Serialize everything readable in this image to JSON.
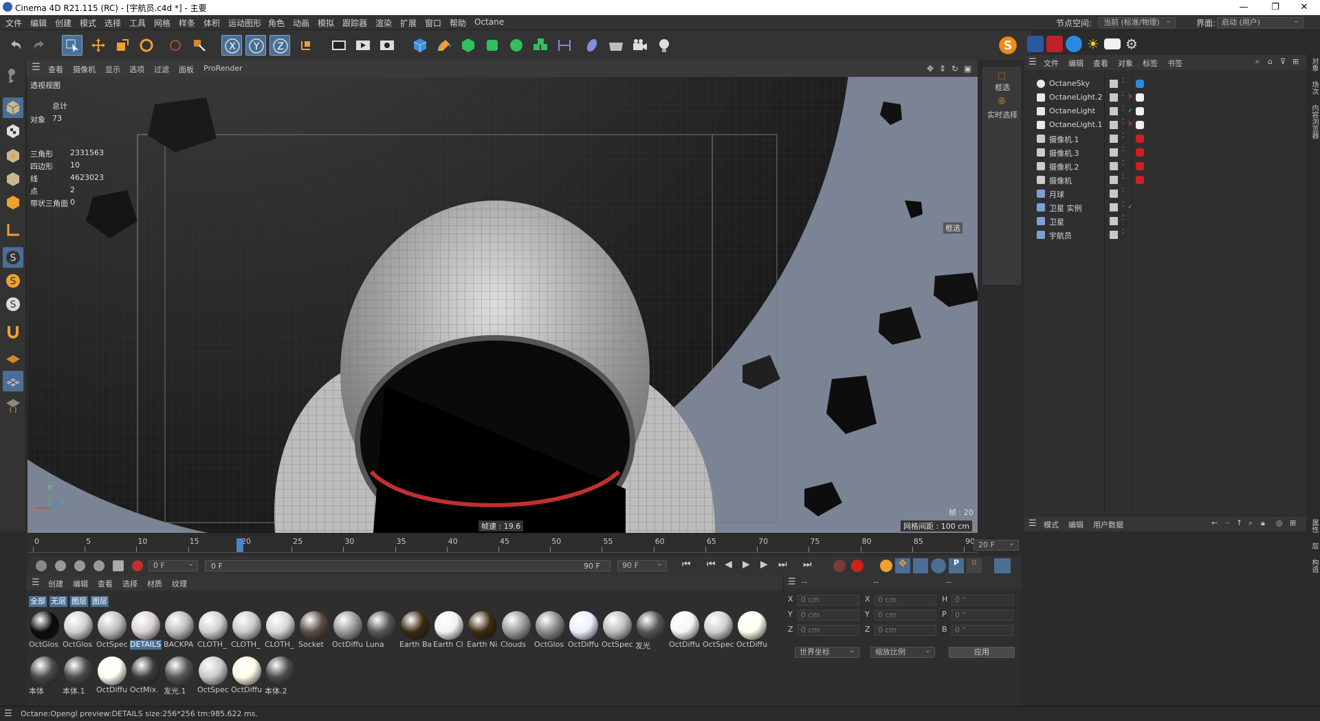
{
  "window": {
    "title": "Cinema 4D R21.115 (RC) - [宇航员.c4d *] - 主要",
    "min": "—",
    "max": "❐",
    "close": "✕"
  },
  "menu": [
    "文件",
    "编辑",
    "创建",
    "模式",
    "选择",
    "工具",
    "网格",
    "样条",
    "体积",
    "运动图形",
    "角色",
    "动画",
    "模拟",
    "跟踪器",
    "渲染",
    "扩展",
    "窗口",
    "帮助",
    "Octane"
  ],
  "node_space": {
    "label": "节点空间:",
    "value": "当前 (标准/物理)"
  },
  "interface": {
    "label": "界面:",
    "value": "启动 (用户)"
  },
  "viewport_menu": [
    "查看",
    "摄像机",
    "显示",
    "选项",
    "过滤",
    "面板",
    "ProRender"
  ],
  "viewport": {
    "name": "透视视图",
    "stats": {
      "total_label": "总计",
      "rows": [
        [
          "对象",
          "73"
        ],
        [
          "三角形",
          "2331563"
        ],
        [
          "四边形",
          "10"
        ],
        [
          "线",
          "4623023"
        ],
        [
          "点",
          "2"
        ],
        [
          "带状三角面",
          "0"
        ]
      ]
    },
    "fps": "帧速 : 19.6",
    "frame": "帧 : 20",
    "grid": "网格间距 : 100 cm",
    "filter_tag": "框选",
    "axes": {
      "x": "X",
      "y": "Y",
      "z": "Z"
    }
  },
  "right_strip": {
    "select": "框选",
    "live": "实时选择"
  },
  "object_manager": {
    "menu": [
      "文件",
      "编辑",
      "查看",
      "对象",
      "标签",
      "书签"
    ],
    "objects": [
      {
        "name": "OctaneSky",
        "check": ""
      },
      {
        "name": "OctaneLight.2",
        "check": "✕"
      },
      {
        "name": "OctaneLight",
        "check": "✓"
      },
      {
        "name": "OctaneLight.1",
        "check": "✕"
      },
      {
        "name": "摄像机.1",
        "check": ""
      },
      {
        "name": "摄像机.3",
        "check": ""
      },
      {
        "name": "摄像机.2",
        "check": ""
      },
      {
        "name": "摄像机",
        "check": ""
      },
      {
        "name": "月球",
        "check": ""
      },
      {
        "name": "卫星 实例",
        "check": "✓"
      },
      {
        "name": "卫星",
        "check": ""
      },
      {
        "name": "宇航员",
        "check": ""
      }
    ]
  },
  "right_tabs": [
    "对象",
    "场次",
    "内容浏览器"
  ],
  "right_tabs2": [
    "属性",
    "层",
    "构造"
  ],
  "attributes": {
    "menu": [
      "模式",
      "编辑",
      "用户数据"
    ]
  },
  "timeline": {
    "ticks": [
      "0",
      "5",
      "10",
      "15",
      "20",
      "25",
      "30",
      "35",
      "40",
      "45",
      "50",
      "55",
      "60",
      "65",
      "70",
      "75",
      "80",
      "85",
      "90"
    ],
    "current": "20 F",
    "current_frame": 20,
    "max_frame": 90
  },
  "transport": {
    "start": "0 F",
    "range_start": "0 F",
    "range_end": "90 F",
    "end": "90 F"
  },
  "material_manager": {
    "menu": [
      "创建",
      "编辑",
      "查看",
      "选择",
      "材质",
      "纹理"
    ],
    "filters": [
      "全部",
      "无层",
      "图层",
      "图层"
    ],
    "materials": [
      {
        "label": "OctGlos",
        "color": "#0b0b0b"
      },
      {
        "label": "OctGlos",
        "color": "#cfcfcf"
      },
      {
        "label": "OctSpec",
        "color": "#bdbdbd"
      },
      {
        "label": "DETAILS",
        "color": "#d9d0d0"
      },
      {
        "label": "BACKPA",
        "color": "#bbbbbb"
      },
      {
        "label": "CLOTH_",
        "color": "#cfcfcf"
      },
      {
        "label": "CLOTH_",
        "color": "#c9c9c9"
      },
      {
        "label": "CLOTH_",
        "color": "#d4d4d4"
      },
      {
        "label": "Socket",
        "color": "#5a4d44"
      },
      {
        "label": "OctDiffu",
        "color": "#999999"
      },
      {
        "label": "Luna",
        "color": "#555555"
      },
      {
        "label": "Earth Ba",
        "color": "#3a2a10"
      },
      {
        "label": "Earth Cl",
        "color": "#f2f2f2"
      },
      {
        "label": "Earth Ni",
        "color": "#3a2a10"
      },
      {
        "label": "Clouds",
        "color": "#999999"
      },
      {
        "label": "OctGlos",
        "color": "#8a8a8a"
      },
      {
        "label": "OctDiffu",
        "color": "#e8f0ff"
      },
      {
        "label": "OctSpec",
        "color": "#bcbcbc"
      },
      {
        "label": "发光",
        "color": "#555555"
      },
      {
        "label": "OctDiffu",
        "color": "#f5f5f5"
      },
      {
        "label": "OctSpec",
        "color": "#cfcfcf"
      },
      {
        "label": "OctDiffu",
        "color": "#fffff0"
      },
      {
        "label": "本体",
        "color": "#4a4a4a"
      },
      {
        "label": "本体.1",
        "color": "#4a4a4a"
      },
      {
        "label": "OctDiffu",
        "color": "#fffff5"
      },
      {
        "label": "OctMix.",
        "color": "#3a3a3a"
      },
      {
        "label": "发光.1",
        "color": "#555555"
      },
      {
        "label": "OctSpec",
        "color": "#c8c8c8"
      },
      {
        "label": "OctDiffu",
        "color": "#fffbe8"
      },
      {
        "label": "本体.2",
        "color": "#4a4a4a"
      }
    ],
    "selected_index": 3
  },
  "coords": {
    "head": [
      "--",
      "--",
      "--"
    ],
    "rows": [
      [
        "X",
        "0 cm",
        "X",
        "0 cm",
        "H",
        "0 °"
      ],
      [
        "Y",
        "0 cm",
        "Y",
        "0 cm",
        "P",
        "0 °"
      ],
      [
        "Z",
        "0 cm",
        "Z",
        "0 cm",
        "B",
        "0 °"
      ]
    ],
    "mode1": "世界坐标",
    "mode2": "缩放比例",
    "apply": "应用"
  },
  "status": "Octane:Opengl preview:DETAILS  size:256*256  tm:985.622 ms.",
  "colors": {
    "accent": "#4b6f94",
    "bg": "#2b2b2b",
    "panel": "#333333"
  }
}
